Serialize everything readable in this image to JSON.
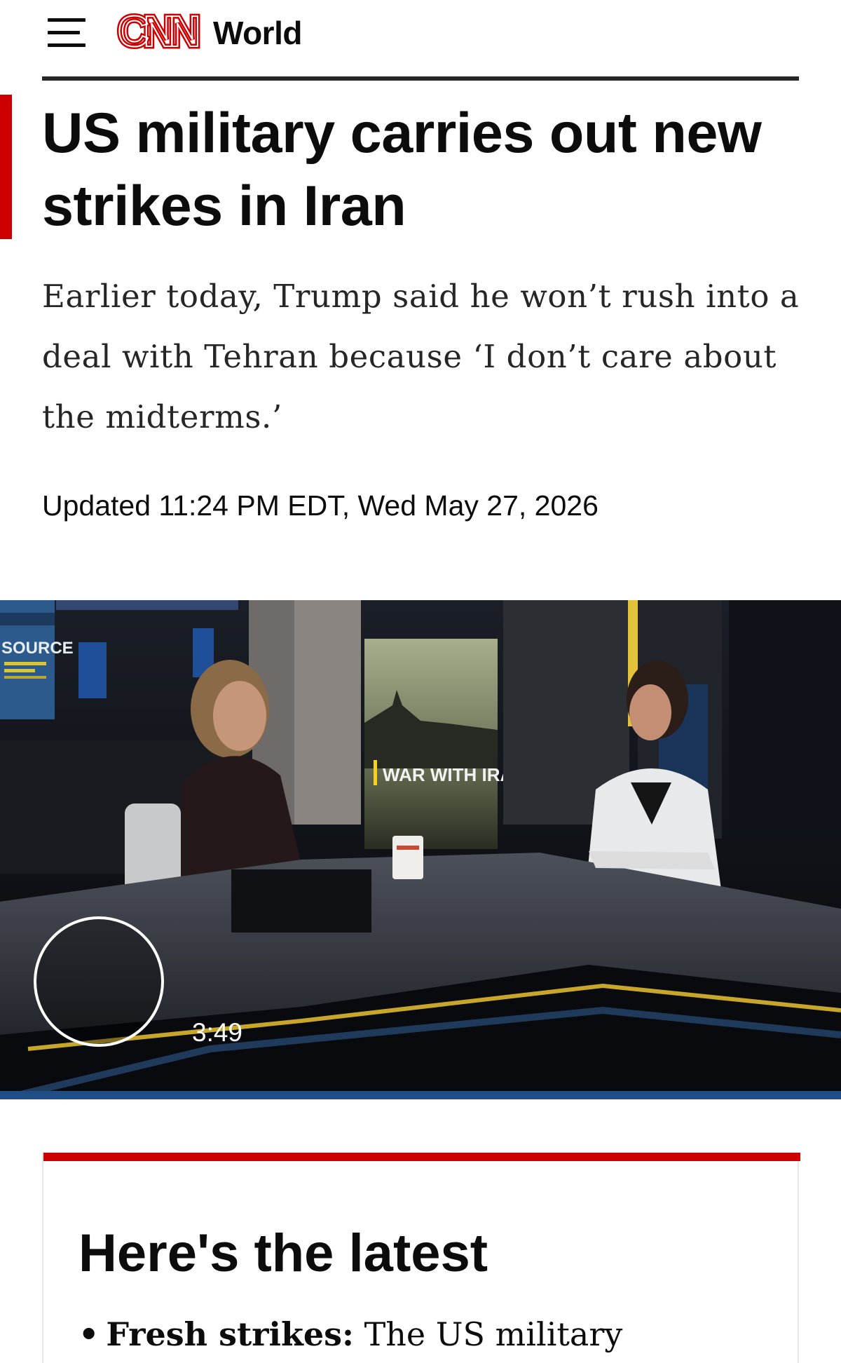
{
  "header": {
    "brand": "CNN",
    "section": "World"
  },
  "article": {
    "headline": "US military carries out new strikes in Iran",
    "dek": "Earlier today, Trump said he won’t rush into a deal with Tehran because ‘I don’t care about the midterms.’",
    "updated": "Updated 11:24 PM EDT, Wed May 27, 2026"
  },
  "video": {
    "duration": "3:49",
    "screen_graphic": "WAR WITH IRAN",
    "wall_text": "SOURCE"
  },
  "latest": {
    "title": "Here's the latest",
    "bullets": [
      {
        "lead": "Fresh strikes:",
        "text": "The US military"
      }
    ]
  },
  "colors": {
    "brand_red": "#cc0000",
    "text": "#0c0c0c",
    "rule": "#262626"
  }
}
